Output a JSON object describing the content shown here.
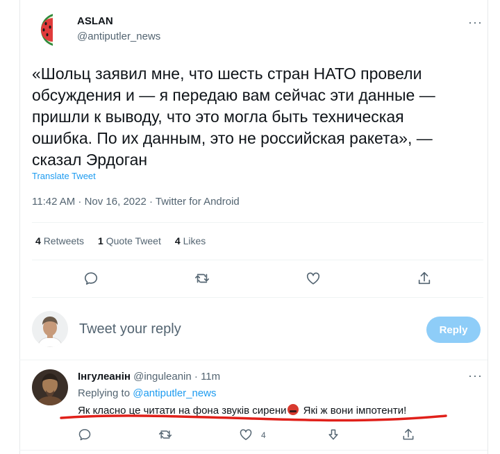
{
  "tweet": {
    "author_name": "ASLAN",
    "author_handle": "@antiputler_news",
    "more": "···",
    "text": "«Шольц заявил мне, что шесть стран НАТО провели\nобсуждения и — я передаю вам сейчас эти данные —\nпришли к выводу, что это могла быть техническая\nошибка. По их данным, это не российская ракета», —\nсказал Эрдоган",
    "translate_label": "Translate Tweet",
    "timestamp": "11:42 AM · Nov 16, 2022 · Twitter for Android",
    "stats": {
      "retweets_count": "4",
      "retweets_label": "Retweets",
      "quotes_count": "1",
      "quotes_label": "Quote Tweet",
      "likes_count": "4",
      "likes_label": "Likes"
    }
  },
  "composer": {
    "placeholder": "Tweet your reply",
    "reply_button": "Reply"
  },
  "reply": {
    "author_name": "Інгулеанін",
    "author_handle": "@inguleanin",
    "time": "· 11m",
    "more": "···",
    "replying_prefix": "Replying to",
    "replying_mention": "@antiputler_news",
    "text_part1": "Як класно це читати на фона звуків сирени",
    "text_part2": " Які ж вони імпотенти!",
    "like_count": "4"
  },
  "colors": {
    "accent": "#1d9bf0",
    "reply_button_disabled": "#8ecdf8",
    "secondary_text": "#536471",
    "annotation_red": "#e0201a"
  },
  "icons": [
    "watermelon-icon",
    "reply-icon",
    "retweet-icon",
    "like-icon",
    "share-icon",
    "downvote-icon",
    "angry-emoji-icon"
  ]
}
